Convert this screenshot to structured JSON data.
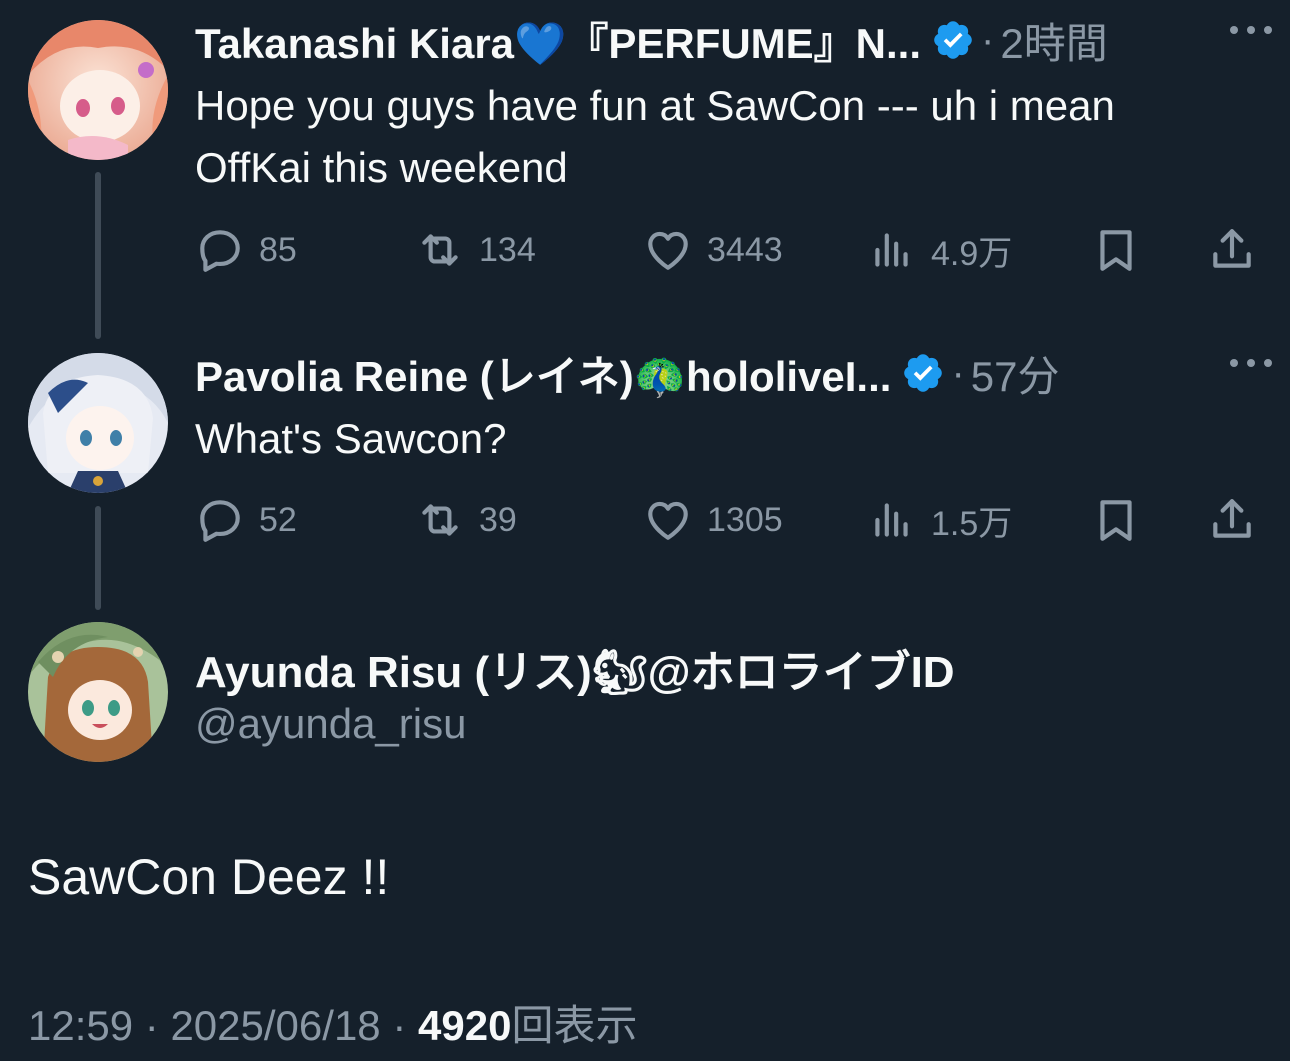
{
  "replies": [
    {
      "display_name": "Takanashi Kiara💙『PERFUME』N...",
      "verified": true,
      "time": "2時間",
      "text": "Hope you guys have fun at SawCon --- uh i mean OffKai this weekend",
      "stats": {
        "replies": "85",
        "reposts": "134",
        "likes": "3443",
        "views": "4.9万"
      }
    },
    {
      "display_name": "Pavolia Reine (レイネ)🦚hololiveI...",
      "verified": true,
      "time": "57分",
      "text": "What's Sawcon?",
      "stats": {
        "replies": "52",
        "reposts": "39",
        "likes": "1305",
        "views": "1.5万"
      }
    }
  ],
  "main_post": {
    "display_name": "Ayunda Risu (リス)🐿@ホロライブID",
    "handle": "@ayunda_risu",
    "text": "SawCon Deez !!",
    "time": "12:59",
    "date": "2025/06/18",
    "views_count": "4920",
    "views_label": "回表示",
    "separator": "·"
  },
  "colors": {
    "background": "#15202b",
    "text_primary": "#f7f9f9",
    "text_secondary": "#8b98a5",
    "verified_blue": "#1d9bf0",
    "thread_line": "#3f4b57"
  },
  "icons": [
    "reply-icon",
    "repost-icon",
    "like-icon",
    "views-icon",
    "bookmark-icon",
    "share-icon",
    "more-icon",
    "verified-badge-icon"
  ]
}
